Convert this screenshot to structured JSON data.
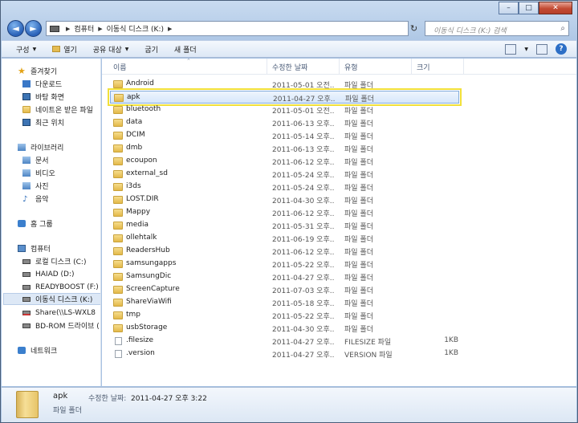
{
  "address": {
    "crumbs": [
      "컴퓨터",
      "이동식 디스크 (K:)"
    ],
    "search_placeholder": "이동식 디스크 (K:) 검색"
  },
  "toolbar": {
    "organize": "구성",
    "open": "열기",
    "share": "공유 대상",
    "burn": "굽기",
    "new_folder": "새 폴더"
  },
  "nav": {
    "favorites": "즐겨찾기",
    "fav_items": [
      "다운로드",
      "바탕 화면",
      "네이트온 받은 파일",
      "최근 위치"
    ],
    "libraries": "라이브러리",
    "lib_items": [
      "문서",
      "비디오",
      "사진",
      "음악"
    ],
    "homegroup": "홈 그룹",
    "computer": "컴퓨터",
    "drives": [
      "로컬 디스크 (C:)",
      "HAIAD (D:)",
      "READYBOOST (F:)",
      "이동식 디스크 (K:)",
      "Share(\\\\LS-WXL8",
      "BD-ROM 드라이브 ("
    ],
    "network": "네트워크"
  },
  "columns": {
    "name": "이름",
    "date": "수정한 날짜",
    "type": "유형",
    "size": "크기"
  },
  "files": [
    {
      "name": "Android",
      "date": "2011-05-01 오전...",
      "type": "파일 폴더",
      "size": "",
      "kind": "folder"
    },
    {
      "name": "apk",
      "date": "2011-04-27 오후...",
      "type": "파일 폴더",
      "size": "",
      "kind": "folder"
    },
    {
      "name": "bluetooth",
      "date": "2011-05-01 오전...",
      "type": "파일 폴더",
      "size": "",
      "kind": "folder"
    },
    {
      "name": "data",
      "date": "2011-06-13 오후...",
      "type": "파일 폴더",
      "size": "",
      "kind": "folder"
    },
    {
      "name": "DCIM",
      "date": "2011-05-14 오후...",
      "type": "파일 폴더",
      "size": "",
      "kind": "folder"
    },
    {
      "name": "dmb",
      "date": "2011-06-13 오후...",
      "type": "파일 폴더",
      "size": "",
      "kind": "folder"
    },
    {
      "name": "ecoupon",
      "date": "2011-06-12 오후...",
      "type": "파일 폴더",
      "size": "",
      "kind": "folder"
    },
    {
      "name": "external_sd",
      "date": "2011-05-24 오후...",
      "type": "파일 폴더",
      "size": "",
      "kind": "folder"
    },
    {
      "name": "i3ds",
      "date": "2011-05-24 오후...",
      "type": "파일 폴더",
      "size": "",
      "kind": "folder"
    },
    {
      "name": "LOST.DIR",
      "date": "2011-04-30 오후...",
      "type": "파일 폴더",
      "size": "",
      "kind": "folder"
    },
    {
      "name": "Mappy",
      "date": "2011-06-12 오후...",
      "type": "파일 폴더",
      "size": "",
      "kind": "folder"
    },
    {
      "name": "media",
      "date": "2011-05-31 오후...",
      "type": "파일 폴더",
      "size": "",
      "kind": "folder"
    },
    {
      "name": "ollehtalk",
      "date": "2011-06-19 오후...",
      "type": "파일 폴더",
      "size": "",
      "kind": "folder"
    },
    {
      "name": "ReadersHub",
      "date": "2011-06-12 오후...",
      "type": "파일 폴더",
      "size": "",
      "kind": "folder"
    },
    {
      "name": "samsungapps",
      "date": "2011-05-22 오후...",
      "type": "파일 폴더",
      "size": "",
      "kind": "folder"
    },
    {
      "name": "SamsungDic",
      "date": "2011-04-27 오후...",
      "type": "파일 폴더",
      "size": "",
      "kind": "folder"
    },
    {
      "name": "ScreenCapture",
      "date": "2011-07-03 오후...",
      "type": "파일 폴더",
      "size": "",
      "kind": "folder"
    },
    {
      "name": "ShareViaWifi",
      "date": "2011-05-18 오후...",
      "type": "파일 폴더",
      "size": "",
      "kind": "folder"
    },
    {
      "name": "tmp",
      "date": "2011-05-22 오후...",
      "type": "파일 폴더",
      "size": "",
      "kind": "folder"
    },
    {
      "name": "usbStorage",
      "date": "2011-04-30 오후...",
      "type": "파일 폴더",
      "size": "",
      "kind": "folder"
    },
    {
      "name": ".filesize",
      "date": "2011-04-27 오후...",
      "type": "FILESIZE 파일",
      "size": "1KB",
      "kind": "file"
    },
    {
      "name": ".version",
      "date": "2011-04-27 오후...",
      "type": "VERSION 파일",
      "size": "1KB",
      "kind": "file"
    }
  ],
  "selected_index": 1,
  "details": {
    "name": "apk",
    "modified_label": "수정한 날짜:",
    "modified_value": "2011-04-27 오후 3:22",
    "type": "파일 폴더"
  },
  "icons": [
    "back-icon",
    "forward-icon",
    "refresh-icon",
    "search-icon",
    "star-icon",
    "folder-icon",
    "file-icon",
    "drive-icon",
    "help-icon"
  ]
}
